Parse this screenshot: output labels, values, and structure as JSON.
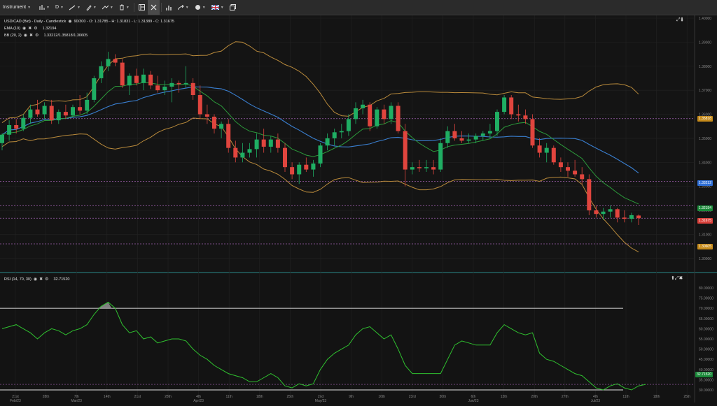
{
  "toolbar": {
    "instrument": "Instrument",
    "timeframe": "D",
    "items": [
      "bar-chart-icon",
      "pen-line-icon",
      "brush-icon",
      "draw-tools-icon",
      "trash-icon",
      "layout-icon",
      "crosshair-icon",
      "indicators-icon",
      "arrow-icon",
      "theme-icon",
      "language-flag-icon",
      "window-icon"
    ]
  },
  "main_chart": {
    "symbol_line": "USD/CAD (Bid) - Daily - Candlestick",
    "bars_info": "90/300 - O: 1.31785 - H: 1.31831 - L: 1.31389 - C: 1.31675",
    "ema_label": "EMA (10)",
    "ema_value": "1.32194",
    "bb_label": "BB (20, 2)",
    "bb_values": "1.33212/1.35818/1.30605",
    "price_ticks": [
      "1.40000",
      "1.39000",
      "1.38000",
      "1.37000",
      "1.35818",
      "1.35000",
      "1.34000",
      "1.33212",
      "1.32194",
      "1.31675",
      "1.31000",
      "1.30605",
      "1.30000"
    ],
    "tags": {
      "bb_upper": "1.35818",
      "bb_mid": "1.33212",
      "ema": "1.32194",
      "last": "1.31675",
      "bb_lower": "1.30605"
    },
    "colors": {
      "up": "#1fae63",
      "down": "#e0453e",
      "ema": "#2c9a3b",
      "bb_mid": "#3a7fd0",
      "bb_band": "#b98a3b",
      "dashed": "#a060b0"
    }
  },
  "rsi": {
    "label": "RSI (14, 70, 30)",
    "value": "32.71520",
    "ticks": [
      "80.00000",
      "75.00000",
      "70.00000",
      "65.00000",
      "60.00000",
      "55.00000",
      "50.00000",
      "45.00000",
      "40.00000",
      "35.00000",
      "32.71520",
      "30.00000"
    ]
  },
  "x_axis": {
    "labels": [
      "21st Feb/23",
      "28th",
      "7th Mar/23",
      "14th",
      "21st",
      "28th",
      "4th Apr/23",
      "11th",
      "18th",
      "25th",
      "2nd May/23",
      "9th",
      "16th",
      "23rd",
      "30th",
      "6th Jun/23",
      "13th",
      "20th",
      "27th",
      "4th Jul/23",
      "11th",
      "18th",
      "25th"
    ]
  },
  "chart_data": {
    "type": "candlestick",
    "title": "USD/CAD (Bid) - Daily - Candlestick",
    "candles": [
      {
        "o": 1.348,
        "h": 1.352,
        "l": 1.345,
        "c": 1.3515
      },
      {
        "o": 1.3515,
        "h": 1.3575,
        "l": 1.349,
        "c": 1.3555
      },
      {
        "o": 1.3555,
        "h": 1.358,
        "l": 1.352,
        "c": 1.354
      },
      {
        "o": 1.354,
        "h": 1.36,
        "l": 1.353,
        "c": 1.3585
      },
      {
        "o": 1.3585,
        "h": 1.364,
        "l": 1.356,
        "c": 1.362
      },
      {
        "o": 1.362,
        "h": 1.366,
        "l": 1.359,
        "c": 1.36
      },
      {
        "o": 1.36,
        "h": 1.365,
        "l": 1.358,
        "c": 1.3635
      },
      {
        "o": 1.3635,
        "h": 1.366,
        "l": 1.356,
        "c": 1.3575
      },
      {
        "o": 1.3575,
        "h": 1.362,
        "l": 1.356,
        "c": 1.361
      },
      {
        "o": 1.361,
        "h": 1.364,
        "l": 1.358,
        "c": 1.3595
      },
      {
        "o": 1.3595,
        "h": 1.364,
        "l": 1.359,
        "c": 1.363
      },
      {
        "o": 1.363,
        "h": 1.368,
        "l": 1.36,
        "c": 1.3615
      },
      {
        "o": 1.3615,
        "h": 1.369,
        "l": 1.36,
        "c": 1.366
      },
      {
        "o": 1.366,
        "h": 1.376,
        "l": 1.365,
        "c": 1.375
      },
      {
        "o": 1.375,
        "h": 1.382,
        "l": 1.373,
        "c": 1.38
      },
      {
        "o": 1.38,
        "h": 1.386,
        "l": 1.378,
        "c": 1.383
      },
      {
        "o": 1.383,
        "h": 1.385,
        "l": 1.38,
        "c": 1.3815
      },
      {
        "o": 1.3815,
        "h": 1.383,
        "l": 1.371,
        "c": 1.372
      },
      {
        "o": 1.372,
        "h": 1.377,
        "l": 1.368,
        "c": 1.376
      },
      {
        "o": 1.376,
        "h": 1.379,
        "l": 1.372,
        "c": 1.373
      },
      {
        "o": 1.373,
        "h": 1.379,
        "l": 1.37,
        "c": 1.3765
      },
      {
        "o": 1.3765,
        "h": 1.378,
        "l": 1.3705,
        "c": 1.372
      },
      {
        "o": 1.372,
        "h": 1.376,
        "l": 1.369,
        "c": 1.37
      },
      {
        "o": 1.37,
        "h": 1.374,
        "l": 1.368,
        "c": 1.3715
      },
      {
        "o": 1.3715,
        "h": 1.375,
        "l": 1.365,
        "c": 1.373
      },
      {
        "o": 1.373,
        "h": 1.374,
        "l": 1.369,
        "c": 1.3725
      },
      {
        "o": 1.3725,
        "h": 1.38,
        "l": 1.371,
        "c": 1.373
      },
      {
        "o": 1.373,
        "h": 1.375,
        "l": 1.366,
        "c": 1.368
      },
      {
        "o": 1.368,
        "h": 1.372,
        "l": 1.358,
        "c": 1.36
      },
      {
        "o": 1.36,
        "h": 1.364,
        "l": 1.356,
        "c": 1.359
      },
      {
        "o": 1.359,
        "h": 1.36,
        "l": 1.352,
        "c": 1.354
      },
      {
        "o": 1.354,
        "h": 1.357,
        "l": 1.35,
        "c": 1.356
      },
      {
        "o": 1.356,
        "h": 1.358,
        "l": 1.344,
        "c": 1.346
      },
      {
        "o": 1.346,
        "h": 1.349,
        "l": 1.34,
        "c": 1.342
      },
      {
        "o": 1.342,
        "h": 1.348,
        "l": 1.34,
        "c": 1.344
      },
      {
        "o": 1.344,
        "h": 1.348,
        "l": 1.342,
        "c": 1.3455
      },
      {
        "o": 1.3455,
        "h": 1.352,
        "l": 1.342,
        "c": 1.3495
      },
      {
        "o": 1.3495,
        "h": 1.354,
        "l": 1.344,
        "c": 1.3465
      },
      {
        "o": 1.3465,
        "h": 1.351,
        "l": 1.344,
        "c": 1.3495
      },
      {
        "o": 1.3495,
        "h": 1.352,
        "l": 1.344,
        "c": 1.346
      },
      {
        "o": 1.346,
        "h": 1.348,
        "l": 1.336,
        "c": 1.338
      },
      {
        "o": 1.338,
        "h": 1.34,
        "l": 1.333,
        "c": 1.335
      },
      {
        "o": 1.335,
        "h": 1.34,
        "l": 1.331,
        "c": 1.339
      },
      {
        "o": 1.339,
        "h": 1.342,
        "l": 1.336,
        "c": 1.337
      },
      {
        "o": 1.337,
        "h": 1.341,
        "l": 1.334,
        "c": 1.3395
      },
      {
        "o": 1.3395,
        "h": 1.348,
        "l": 1.338,
        "c": 1.347
      },
      {
        "o": 1.347,
        "h": 1.352,
        "l": 1.345,
        "c": 1.35
      },
      {
        "o": 1.35,
        "h": 1.354,
        "l": 1.347,
        "c": 1.3525
      },
      {
        "o": 1.3525,
        "h": 1.356,
        "l": 1.35,
        "c": 1.353
      },
      {
        "o": 1.353,
        "h": 1.36,
        "l": 1.351,
        "c": 1.358
      },
      {
        "o": 1.358,
        "h": 1.365,
        "l": 1.356,
        "c": 1.3625
      },
      {
        "o": 1.3625,
        "h": 1.366,
        "l": 1.36,
        "c": 1.364
      },
      {
        "o": 1.364,
        "h": 1.365,
        "l": 1.353,
        "c": 1.355
      },
      {
        "o": 1.355,
        "h": 1.363,
        "l": 1.354,
        "c": 1.362
      },
      {
        "o": 1.362,
        "h": 1.364,
        "l": 1.356,
        "c": 1.358
      },
      {
        "o": 1.358,
        "h": 1.365,
        "l": 1.356,
        "c": 1.3635
      },
      {
        "o": 1.3635,
        "h": 1.365,
        "l": 1.352,
        "c": 1.353
      },
      {
        "o": 1.353,
        "h": 1.356,
        "l": 1.33,
        "c": 1.337
      },
      {
        "o": 1.337,
        "h": 1.34,
        "l": 1.335,
        "c": 1.338
      },
      {
        "o": 1.338,
        "h": 1.341,
        "l": 1.336,
        "c": 1.3375
      },
      {
        "o": 1.3375,
        "h": 1.341,
        "l": 1.336,
        "c": 1.338
      },
      {
        "o": 1.338,
        "h": 1.341,
        "l": 1.335,
        "c": 1.337
      },
      {
        "o": 1.337,
        "h": 1.35,
        "l": 1.336,
        "c": 1.348
      },
      {
        "o": 1.348,
        "h": 1.355,
        "l": 1.346,
        "c": 1.353
      },
      {
        "o": 1.353,
        "h": 1.356,
        "l": 1.349,
        "c": 1.35
      },
      {
        "o": 1.35,
        "h": 1.353,
        "l": 1.348,
        "c": 1.349
      },
      {
        "o": 1.349,
        "h": 1.352,
        "l": 1.348,
        "c": 1.3495
      },
      {
        "o": 1.3495,
        "h": 1.352,
        "l": 1.348,
        "c": 1.351
      },
      {
        "o": 1.351,
        "h": 1.353,
        "l": 1.349,
        "c": 1.352
      },
      {
        "o": 1.352,
        "h": 1.356,
        "l": 1.35,
        "c": 1.353
      },
      {
        "o": 1.353,
        "h": 1.362,
        "l": 1.351,
        "c": 1.361
      },
      {
        "o": 1.361,
        "h": 1.368,
        "l": 1.36,
        "c": 1.367
      },
      {
        "o": 1.367,
        "h": 1.368,
        "l": 1.358,
        "c": 1.36
      },
      {
        "o": 1.36,
        "h": 1.364,
        "l": 1.357,
        "c": 1.3595
      },
      {
        "o": 1.3595,
        "h": 1.362,
        "l": 1.356,
        "c": 1.358
      },
      {
        "o": 1.358,
        "h": 1.36,
        "l": 1.346,
        "c": 1.347
      },
      {
        "o": 1.347,
        "h": 1.35,
        "l": 1.342,
        "c": 1.344
      },
      {
        "o": 1.344,
        "h": 1.348,
        "l": 1.34,
        "c": 1.346
      },
      {
        "o": 1.346,
        "h": 1.347,
        "l": 1.339,
        "c": 1.34
      },
      {
        "o": 1.34,
        "h": 1.342,
        "l": 1.336,
        "c": 1.338
      },
      {
        "o": 1.338,
        "h": 1.34,
        "l": 1.334,
        "c": 1.3365
      },
      {
        "o": 1.3365,
        "h": 1.341,
        "l": 1.334,
        "c": 1.335
      },
      {
        "o": 1.335,
        "h": 1.338,
        "l": 1.331,
        "c": 1.333
      },
      {
        "o": 1.333,
        "h": 1.335,
        "l": 1.318,
        "c": 1.32
      },
      {
        "o": 1.32,
        "h": 1.322,
        "l": 1.317,
        "c": 1.3185
      },
      {
        "o": 1.3185,
        "h": 1.321,
        "l": 1.316,
        "c": 1.3195
      },
      {
        "o": 1.3195,
        "h": 1.322,
        "l": 1.317,
        "c": 1.3205
      },
      {
        "o": 1.3205,
        "h": 1.321,
        "l": 1.315,
        "c": 1.317
      },
      {
        "o": 1.317,
        "h": 1.32,
        "l": 1.315,
        "c": 1.3165
      },
      {
        "o": 1.3165,
        "h": 1.319,
        "l": 1.315,
        "c": 1.318
      },
      {
        "o": 1.31785,
        "h": 1.31831,
        "l": 1.31389,
        "c": 1.31675
      }
    ],
    "rsi_values": [
      60,
      61,
      62,
      60,
      58,
      55,
      58,
      60,
      59,
      57,
      59,
      60,
      62,
      67,
      71,
      73,
      70,
      62,
      58,
      59,
      55,
      56,
      53,
      54,
      55,
      55,
      54,
      50,
      47,
      45,
      42,
      40,
      38,
      37,
      36,
      34,
      34,
      36,
      38,
      36,
      32,
      31,
      33,
      32,
      33,
      40,
      45,
      48,
      50,
      52,
      57,
      60,
      61,
      58,
      55,
      57,
      50,
      42,
      38,
      38,
      38,
      38,
      38,
      45,
      52,
      54,
      53,
      52,
      52,
      52,
      58,
      62,
      60,
      58,
      57,
      58,
      48,
      45,
      44,
      42,
      40,
      38,
      37,
      34,
      31,
      30,
      32,
      33,
      31,
      30,
      32,
      32.7
    ],
    "ylim_price": [
      1.295,
      1.4
    ],
    "ylim_rsi": [
      30,
      80
    ]
  }
}
